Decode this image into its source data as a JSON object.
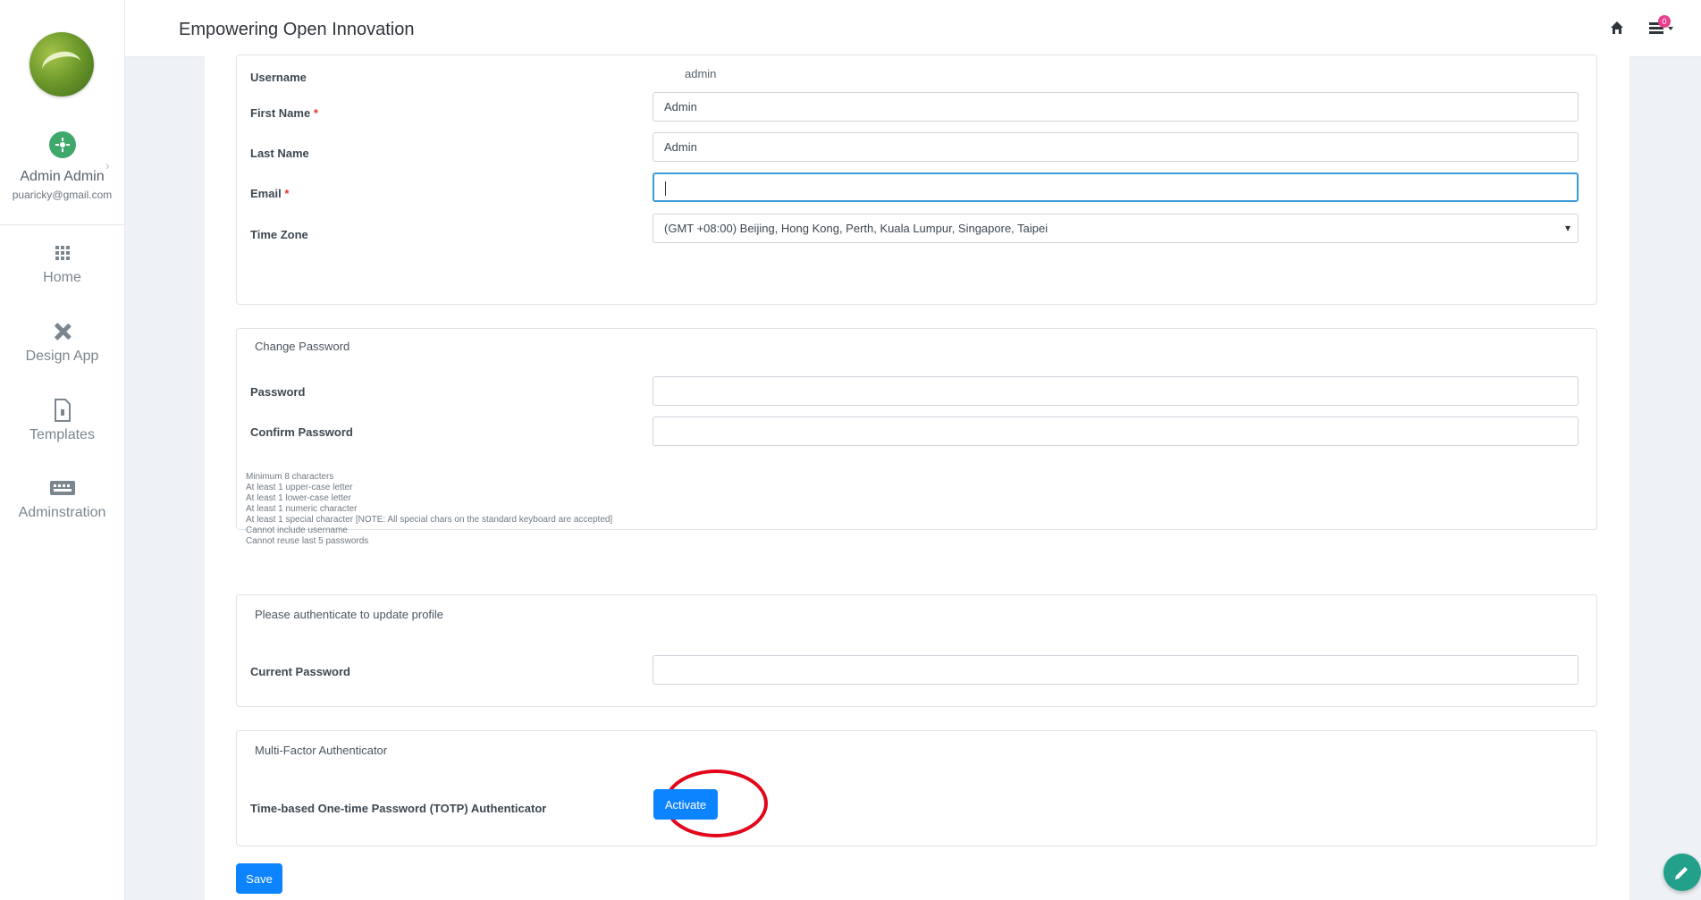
{
  "app": {
    "title": "Empowering Open Innovation"
  },
  "topbar": {
    "notification_count": "0"
  },
  "sidebar": {
    "user": {
      "name": "Admin Admin",
      "email": "puaricky@gmail.com"
    },
    "nav": [
      {
        "label": "Home",
        "icon": "grid-icon"
      },
      {
        "label": "Design App",
        "icon": "design-tools-icon"
      },
      {
        "label": "Templates",
        "icon": "file-icon"
      },
      {
        "label": "Adminstration",
        "icon": "keyboard-icon"
      }
    ]
  },
  "profile": {
    "username_label": "Username",
    "username_value": "admin",
    "first_name_label": "First Name",
    "first_name_value": "Admin",
    "last_name_label": "Last Name",
    "last_name_value": "Admin",
    "email_label": "Email",
    "email_value": "",
    "timezone_label": "Time Zone",
    "timezone_value": "(GMT +08:00) Beijing, Hong Kong, Perth, Kuala Lumpur, Singapore, Taipei",
    "required_marker": "*"
  },
  "change_password": {
    "title": "Change Password",
    "password_label": "Password",
    "confirm_label": "Confirm Password",
    "rules": [
      "Minimum 8 characters",
      "At least 1 upper-case letter",
      "At least 1 lower-case letter",
      "At least 1 numeric character",
      "At least 1 special character [NOTE: All special chars on the standard keyboard are accepted]",
      "Cannot include username",
      "Cannot reuse last 5 passwords"
    ]
  },
  "authenticate": {
    "title": "Please authenticate to update profile",
    "current_password_label": "Current Password"
  },
  "mfa": {
    "title": "Multi-Factor Authenticator",
    "totp_label": "Time-based One-time Password (TOTP) Authenticator",
    "activate_label": "Activate"
  },
  "actions": {
    "save_label": "Save"
  },
  "colors": {
    "primary": "#0d84ff",
    "highlight": "#e3061b",
    "fab": "#23a08a",
    "accent_green": "#3fa86b"
  }
}
